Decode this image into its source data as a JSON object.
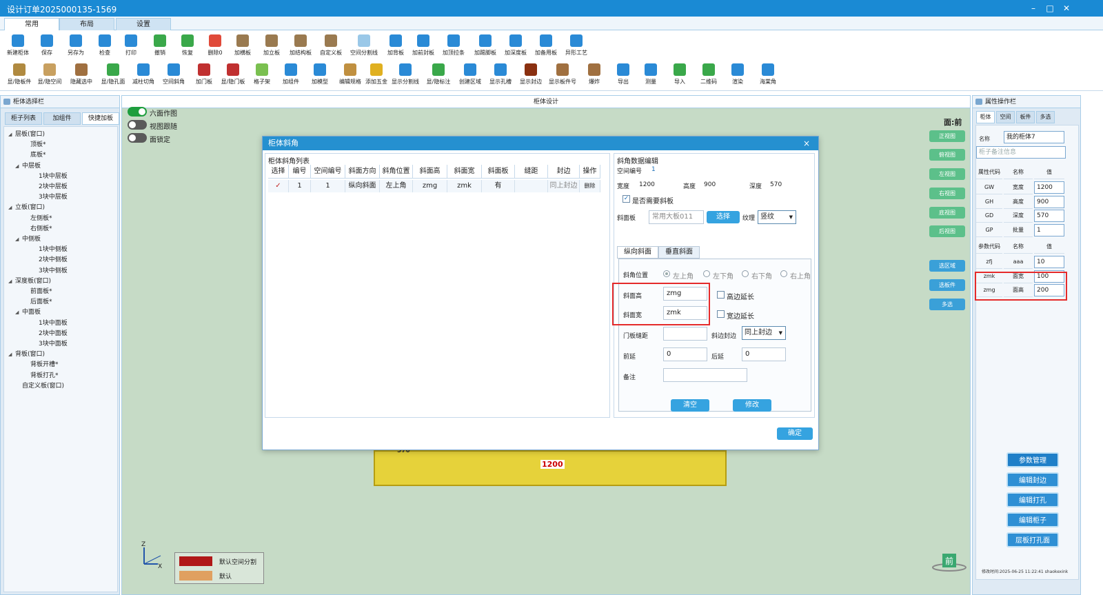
{
  "window": {
    "title": "设计订单2025000135-1569",
    "minimize": "–",
    "maximize": "□",
    "close": "✕"
  },
  "ribbon": {
    "tabs": [
      {
        "label": "常用"
      },
      {
        "label": "布局"
      },
      {
        "label": "设置"
      }
    ],
    "row1": [
      {
        "label": "新建柜体",
        "icon": "new-cabinet-icon",
        "color": "#2a8ad6"
      },
      {
        "label": "保存",
        "icon": "save-icon",
        "color": "#2a8ad6"
      },
      {
        "label": "另存为",
        "icon": "save-as-icon",
        "color": "#2a8ad6"
      },
      {
        "label": "检查",
        "icon": "check-icon",
        "color": "#2a8ad6"
      },
      {
        "label": "打印",
        "icon": "print-icon",
        "color": "#2a8ad6"
      },
      {
        "label": "撤销",
        "icon": "undo-icon",
        "color": "#3aa84a"
      },
      {
        "label": "恢复",
        "icon": "redo-icon",
        "color": "#3aa84a"
      },
      {
        "label": "删除0",
        "icon": "delete-icon",
        "color": "#e04a3a"
      },
      {
        "label": "加横板",
        "icon": "add-horizontal-board-icon",
        "color": "#9a7a50"
      },
      {
        "label": "加立板",
        "icon": "add-vertical-board-icon",
        "color": "#9a7a50"
      },
      {
        "label": "加结构板",
        "icon": "add-structure-board-icon",
        "color": "#9a7a50"
      },
      {
        "label": "自定义板",
        "icon": "custom-board-icon",
        "color": "#9a7a50"
      },
      {
        "label": "空间分割线",
        "icon": "space-divider-icon",
        "color": "#9ac8e8"
      },
      {
        "label": "加背板",
        "icon": "add-back-board-icon",
        "color": "#2a8ad6"
      },
      {
        "label": "加前封板",
        "icon": "add-front-board-icon",
        "color": "#2a8ad6"
      },
      {
        "label": "加顶拉条",
        "icon": "add-top-strip-icon",
        "color": "#2a8ad6"
      },
      {
        "label": "加踢脚板",
        "icon": "add-skirting-icon",
        "color": "#2a8ad6"
      },
      {
        "label": "加深度板",
        "icon": "add-depth-board-icon",
        "color": "#2a8ad6"
      },
      {
        "label": "加备用板",
        "icon": "add-spare-board-icon",
        "color": "#2a8ad6"
      },
      {
        "label": "异形工艺",
        "icon": "special-process-icon",
        "color": "#2a8ad6"
      }
    ],
    "row2": [
      {
        "label": "显/隐板件",
        "icon": "toggle-board-icon",
        "color": "#b08a40"
      },
      {
        "label": "显/隐空间",
        "icon": "toggle-space-icon",
        "color": "#c8a060"
      },
      {
        "label": "隐藏选中",
        "icon": "hide-selected-icon",
        "color": "#a07040"
      },
      {
        "label": "显/隐孔面",
        "icon": "toggle-hole-face-icon",
        "color": "#3aa84a"
      },
      {
        "label": "减柱切角",
        "icon": "column-cut-icon",
        "color": "#2a8ad6"
      },
      {
        "label": "空间斜角",
        "icon": "space-bevel-icon",
        "color": "#2a8ad6"
      },
      {
        "label": "加门板",
        "icon": "add-door-icon",
        "color": "#c03030"
      },
      {
        "label": "显/隐门板",
        "icon": "toggle-door-icon",
        "color": "#c03030"
      },
      {
        "label": "格子架",
        "icon": "grid-rack-icon",
        "color": "#7ac050"
      },
      {
        "label": "加组件",
        "icon": "add-component-icon",
        "color": "#2a8ad6"
      },
      {
        "label": "加模型",
        "icon": "add-model-icon",
        "color": "#2a8ad6"
      },
      {
        "label": "编辑规格",
        "icon": "edit-spec-icon",
        "color": "#c09040"
      },
      {
        "label": "添加五金",
        "icon": "add-hardware-icon",
        "color": "#e0b020"
      },
      {
        "label": "显示分割线",
        "icon": "show-divider-icon",
        "color": "#2a8ad6"
      },
      {
        "label": "显/隐标注",
        "icon": "toggle-dimension-icon",
        "color": "#3aa84a"
      },
      {
        "label": "创建区域",
        "icon": "create-region-icon",
        "color": "#2a8ad6"
      },
      {
        "label": "显示孔槽",
        "icon": "show-holes-icon",
        "color": "#2a8ad6"
      },
      {
        "label": "显示封边",
        "icon": "show-edge-icon",
        "color": "#8a3010"
      },
      {
        "label": "显示板件号",
        "icon": "show-board-number-icon",
        "color": "#a07040"
      },
      {
        "label": "爆炸",
        "icon": "explode-icon",
        "color": "#a07040"
      },
      {
        "label": "导出",
        "icon": "export-icon",
        "color": "#2a8ad6"
      },
      {
        "label": "测量",
        "icon": "measure-icon",
        "color": "#2a8ad6"
      },
      {
        "label": "导入",
        "icon": "import-icon",
        "color": "#3aa84a"
      },
      {
        "label": "二维码",
        "icon": "qrcode-icon",
        "color": "#3aa84a"
      },
      {
        "label": "渲染",
        "icon": "render-icon",
        "color": "#2a8ad6"
      },
      {
        "label": "海棠角",
        "icon": "begonia-corner-icon",
        "color": "#2a8ad6"
      }
    ]
  },
  "left_panel": {
    "title": "柜体选择栏",
    "tabs": [
      {
        "label": "柜子列表"
      },
      {
        "label": "加组件"
      },
      {
        "label": "快捷加板"
      }
    ],
    "tree": [
      {
        "label": "层板(窗口)",
        "arrow": "◢"
      },
      {
        "label": "顶板*",
        "arrow": ""
      },
      {
        "label": "底板*",
        "arrow": ""
      },
      {
        "label": "中层板",
        "arrow": "◢"
      },
      {
        "label": "1块中层板",
        "arrow": ""
      },
      {
        "label": "2块中层板",
        "arrow": ""
      },
      {
        "label": "3块中层板",
        "arrow": ""
      },
      {
        "label": "立板(窗口)",
        "arrow": "◢"
      },
      {
        "label": "左侧板*",
        "arrow": ""
      },
      {
        "label": "右侧板*",
        "arrow": ""
      },
      {
        "label": "中侧板",
        "arrow": "◢"
      },
      {
        "label": "1块中侧板",
        "arrow": ""
      },
      {
        "label": "2块中侧板",
        "arrow": ""
      },
      {
        "label": "3块中侧板",
        "arrow": ""
      },
      {
        "label": "深度板(窗口)",
        "arrow": "◢"
      },
      {
        "label": "前面板*",
        "arrow": ""
      },
      {
        "label": "后面板*",
        "arrow": ""
      },
      {
        "label": "中面板",
        "arrow": "◢"
      },
      {
        "label": "1块中面板",
        "arrow": ""
      },
      {
        "label": "2块中面板",
        "arrow": ""
      },
      {
        "label": "3块中面板",
        "arrow": ""
      },
      {
        "label": "背板(窗口)",
        "arrow": "◢"
      },
      {
        "label": "背板开槽*",
        "arrow": ""
      },
      {
        "label": "背板打孔*",
        "arrow": ""
      },
      {
        "label": "自定义板(窗口)",
        "arrow": ""
      }
    ]
  },
  "canvas": {
    "title": "柜体设计",
    "toggles": [
      {
        "label": "六面作图",
        "on": true
      },
      {
        "label": "视图跟随",
        "on": false
      },
      {
        "label": "面锁定",
        "on": false
      }
    ],
    "face": "面:前",
    "view_buttons": [
      "正视图",
      "俯视图",
      "左视图",
      "右视图",
      "底视图",
      "后视图"
    ],
    "select_buttons": [
      "选区域",
      "选板件",
      "多选"
    ],
    "dim_width": "1200",
    "dim_depth": "570",
    "axis": {
      "z": "Z",
      "x": "X"
    },
    "legend": [
      {
        "label": "默认空间分割",
        "color": "#b01818"
      },
      {
        "label": "默认",
        "color": "#e0a060"
      }
    ],
    "front_badge": "前"
  },
  "right_panel": {
    "title": "属性操作栏",
    "tabs": [
      {
        "label": "柜体"
      },
      {
        "label": "空间"
      },
      {
        "label": "板件"
      },
      {
        "label": "多选"
      }
    ],
    "name_label": "名称",
    "name_value": "我的柜体7",
    "remark_placeholder": "柜子备注信息",
    "attr_headers": [
      "属性代码",
      "名称",
      "值"
    ],
    "attrs": [
      {
        "code": "GW",
        "name": "宽度",
        "value": "1200"
      },
      {
        "code": "GH",
        "name": "高度",
        "value": "900"
      },
      {
        "code": "GD",
        "name": "深度",
        "value": "570"
      },
      {
        "code": "GP",
        "name": "批量",
        "value": "1"
      }
    ],
    "param_headers": [
      "参数代码",
      "名称",
      "值"
    ],
    "params": [
      {
        "code": "zfj",
        "name": "aaa",
        "value": "10"
      },
      {
        "code": "zmk",
        "name": "面宽",
        "value": "100"
      },
      {
        "code": "zmg",
        "name": "面高",
        "value": "200"
      }
    ],
    "buttons": [
      "参数管理",
      "编辑封边",
      "编辑打孔",
      "编辑柜子",
      "层板打孔面"
    ],
    "footer": "修改时间:2025-06-25 11:22:41 shaokexink"
  },
  "dialog": {
    "title": "柜体斜角",
    "close": "×",
    "list_title": "柜体斜角列表",
    "headers": [
      "选择",
      "编号",
      "空间编号",
      "斜面方向",
      "斜角位置",
      "斜面高",
      "斜面宽",
      "斜面板",
      "缝距",
      "封边",
      "操作"
    ],
    "rows": [
      {
        "select": "✓",
        "no": "1",
        "space_no": "1",
        "direction": "纵向斜面",
        "position": "左上角",
        "height": "zmg",
        "width": "zmk",
        "board": "有",
        "gap": "",
        "edge": "同上封边",
        "action": "删除"
      }
    ],
    "editor_title": "斜角数据编辑",
    "space_no_label": "空间编号",
    "space_no": "1",
    "width_label": "宽度",
    "width": "1200",
    "height_label": "高度",
    "height": "900",
    "depth_label": "深度",
    "depth": "570",
    "need_bevel_label": "是否需要斜板",
    "bevel_board_label": "斜面板",
    "bevel_board_value": "常用大板011",
    "select_label": "选择",
    "grain_label": "纹理",
    "grain_value": "竖纹",
    "inner_tabs": [
      {
        "label": "纵向斜面"
      },
      {
        "label": "垂直斜面"
      }
    ],
    "position_label": "斜角位置",
    "positions": [
      "左上角",
      "左下角",
      "右下角",
      "右上角"
    ],
    "bevel_height_label": "斜面高",
    "bevel_height_value": "zmg",
    "bevel_width_label": "斜面宽",
    "bevel_width_value": "zmk",
    "height_extend_label": "高边延长",
    "width_extend_label": "宽边延长",
    "door_gap_label": "门板缝距",
    "door_gap_value": "",
    "edge_label": "斜边封边",
    "edge_value": "同上封边",
    "front_ext_label": "前延",
    "front_ext_value": "0",
    "back_ext_label": "后延",
    "back_ext_value": "0",
    "remark_label": "备注",
    "remark_value": "",
    "clear_btn": "清空",
    "modify_btn": "修改",
    "ok_btn": "确定"
  }
}
